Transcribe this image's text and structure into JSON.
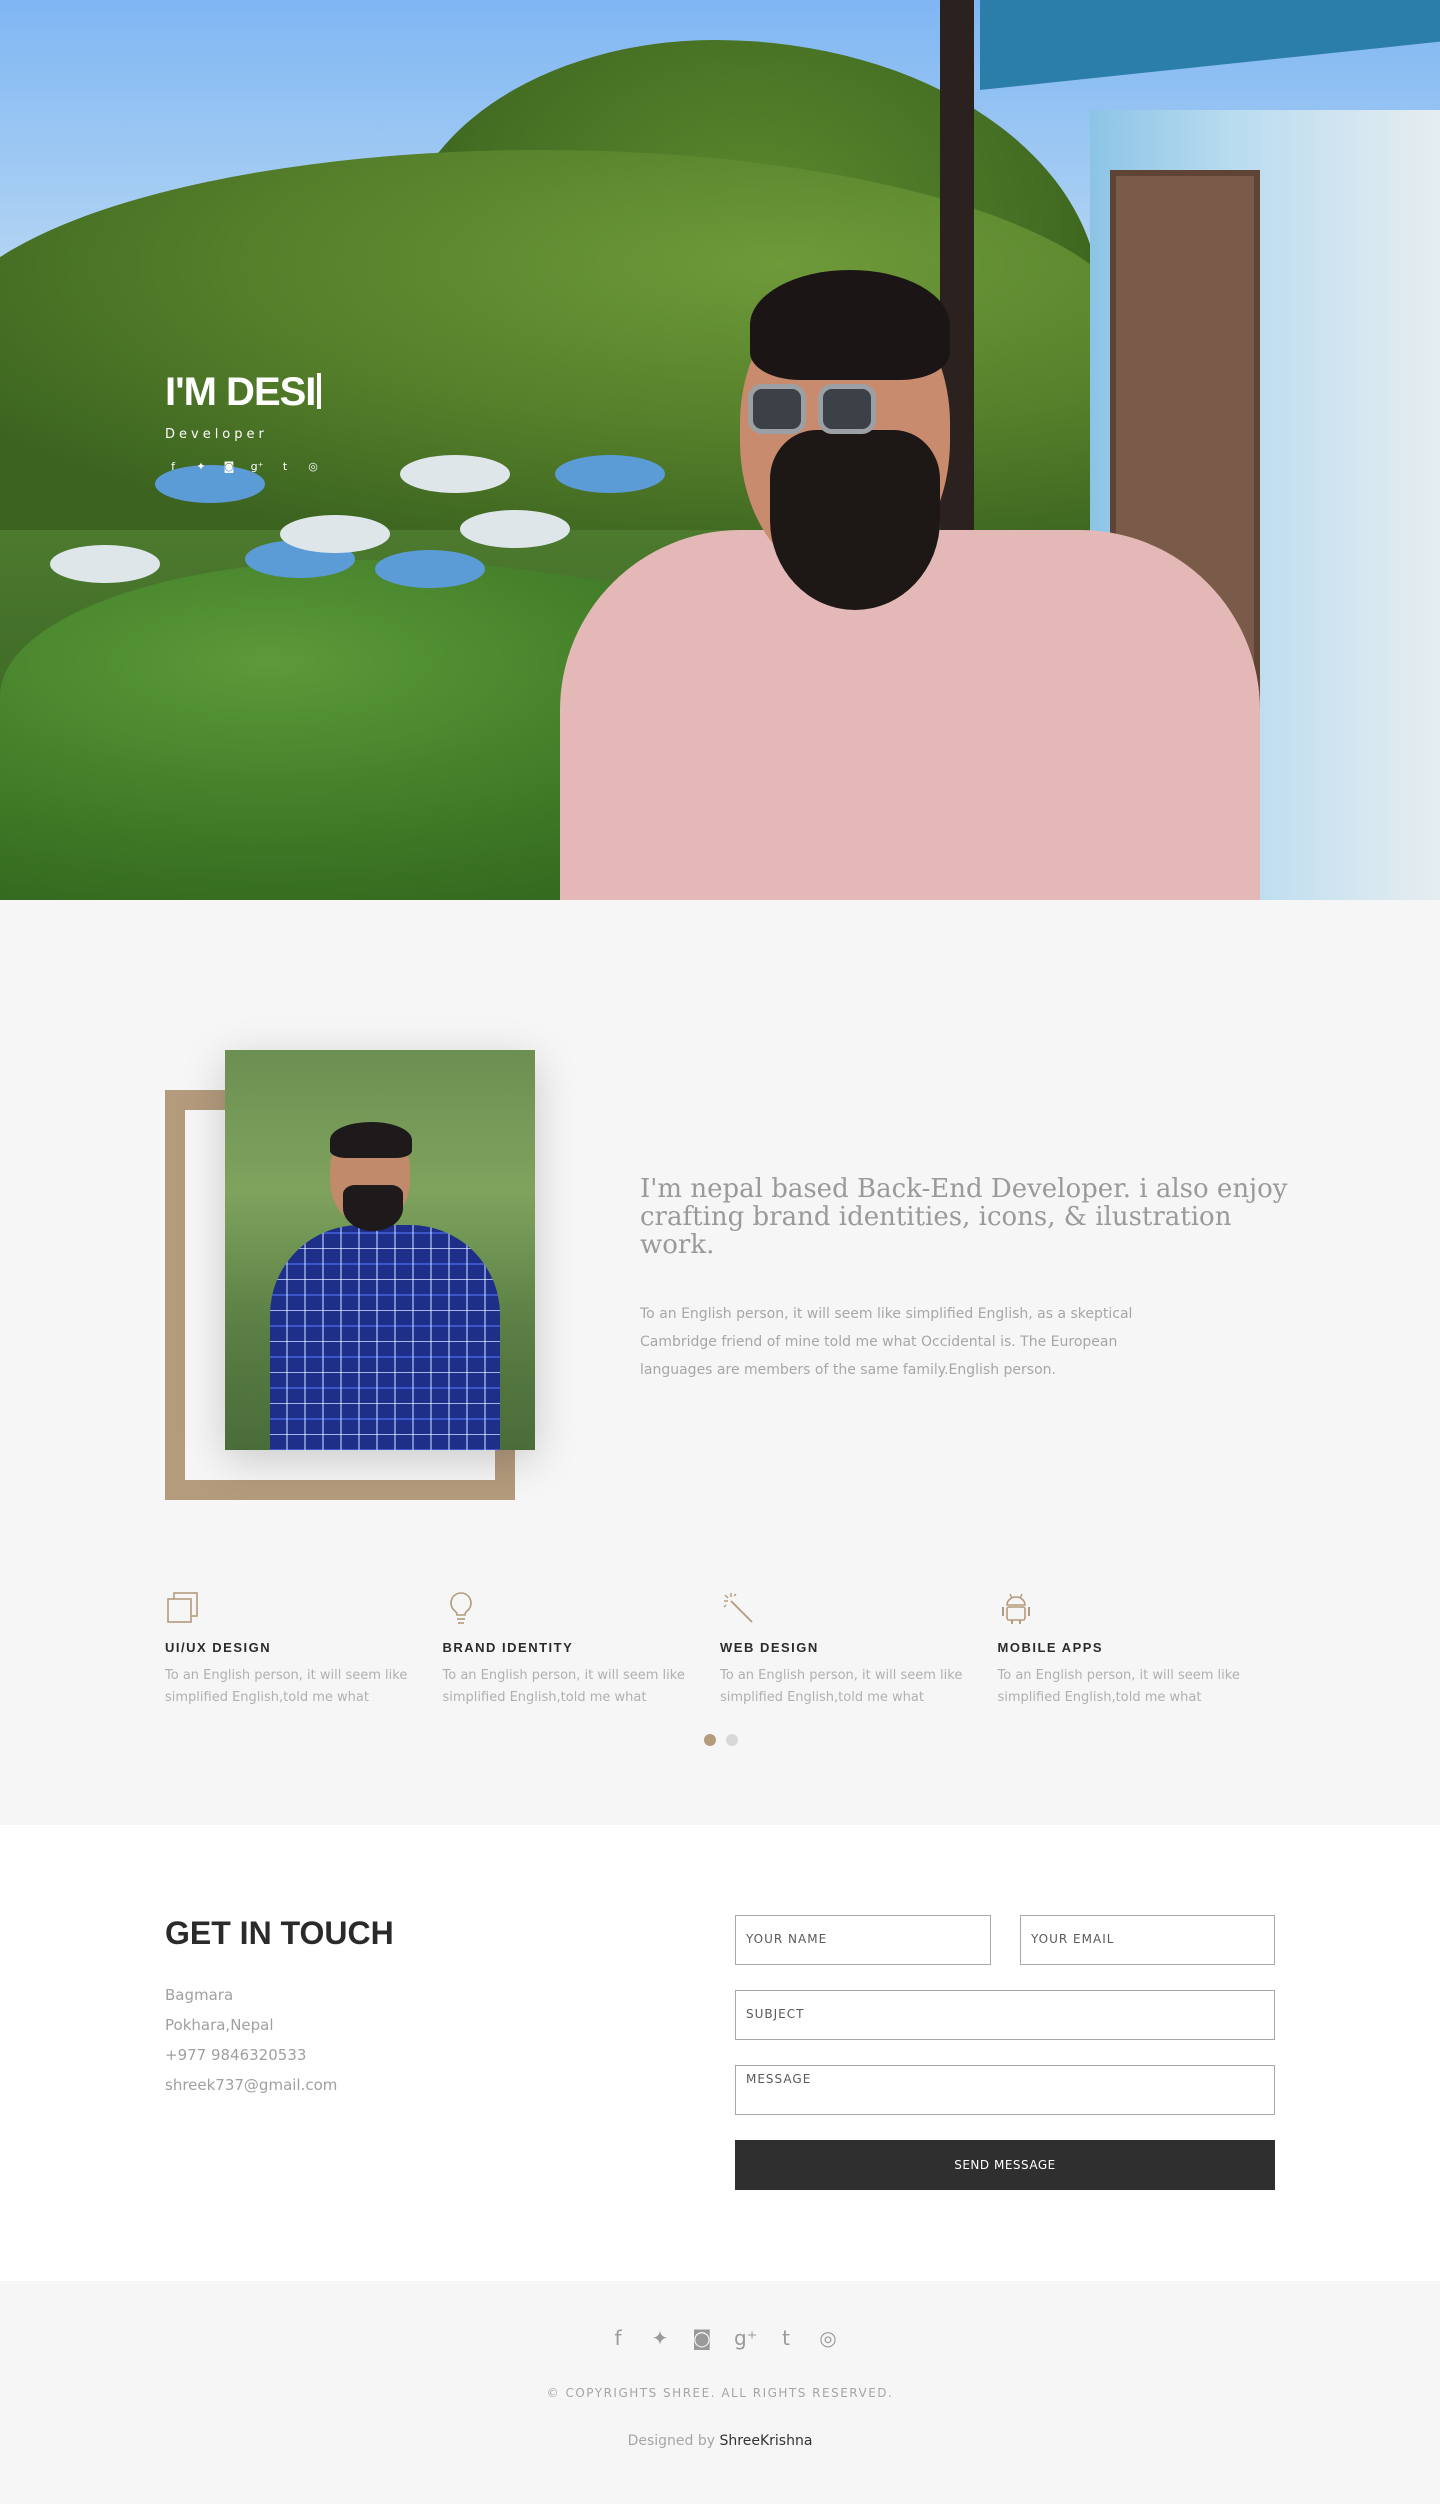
{
  "hero": {
    "title": "I'M DESI",
    "subtitle": "Developer",
    "social_icons": [
      "facebook-icon",
      "twitter-icon",
      "instagram-icon",
      "google-plus-icon",
      "tumblr-icon",
      "dribbble-icon"
    ]
  },
  "about": {
    "heading": "I'm nepal based Back-End Developer. i also enjoy crafting brand identities, icons, & ilustration work.",
    "paragraph": "To an English person, it will seem like simplified English, as a skeptical Cambridge friend of mine told me what Occidental is. The European languages are members of the same family.English person.",
    "accent_color": "#b49b7d"
  },
  "services": [
    {
      "icon": "layers-icon",
      "title": "UI/UX DESIGN",
      "text": "To an English person, it will seem like simplified English,told me what"
    },
    {
      "icon": "lightbulb-icon",
      "title": "BRAND IDENTITY",
      "text": "To an English person, it will seem like simplified English,told me what"
    },
    {
      "icon": "magic-wand-icon",
      "title": "WEB DESIGN",
      "text": "To an English person, it will seem like simplified English,told me what"
    },
    {
      "icon": "android-icon",
      "title": "MOBILE APPS",
      "text": "To an English person, it will seem like simplified English,told me what"
    }
  ],
  "carousel": {
    "active_index": 0,
    "count": 2
  },
  "contact": {
    "heading": "GET IN TOUCH",
    "address_line1": "Bagmara",
    "address_line2": "Pokhara,Nepal",
    "phone": "+977 9846320533",
    "email": "shreek737@gmail.com",
    "form": {
      "name_placeholder": "YOUR NAME",
      "email_placeholder": "YOUR EMAIL",
      "subject_placeholder": "SUBJECT",
      "message_placeholder": "MESSAGE",
      "submit_label": "SEND MESSAGE"
    }
  },
  "footer": {
    "social_icons": [
      "facebook-icon",
      "twitter-icon",
      "instagram-icon",
      "google-plus-icon",
      "tumblr-icon",
      "dribbble-icon"
    ],
    "copyright": "© COPYRIGHTS SHREE. ALL RIGHTS RESERVED.",
    "designed_by_prefix": "Designed by",
    "designer": "ShreeKrishna"
  }
}
